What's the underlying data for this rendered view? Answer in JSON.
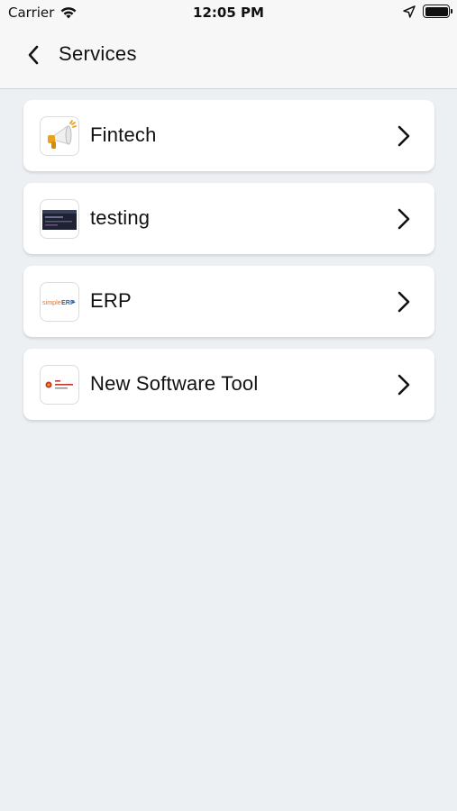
{
  "status_bar": {
    "carrier": "Carrier",
    "time": "12:05 PM",
    "icons": [
      "wifi-icon",
      "location-arrow-icon",
      "battery-icon"
    ]
  },
  "nav": {
    "title": "Services",
    "back_icon": "chevron-left-icon"
  },
  "services": [
    {
      "label": "Fintech",
      "icon": "megaphone-image"
    },
    {
      "label": "testing",
      "icon": "dark-screenshot-image"
    },
    {
      "label": "ERP",
      "icon": "simpleerp-logo",
      "logo_text": "simpleERP"
    },
    {
      "label": "New Software Tool",
      "icon": "software-tool-logo"
    }
  ],
  "colors": {
    "background": "#edf0f3",
    "bar": "#f7f7f7",
    "card": "#ffffff",
    "text": "#111111"
  }
}
